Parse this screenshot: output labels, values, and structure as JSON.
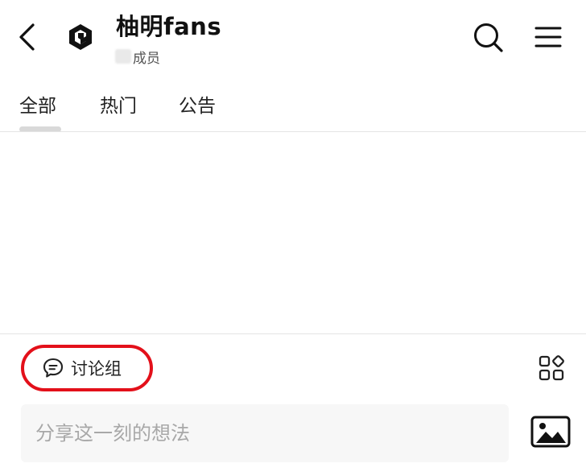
{
  "header": {
    "title": "柚明fans",
    "subtitle_suffix": "成员",
    "icons": {
      "back": "chevron-left-icon",
      "logo": "group-logo-icon",
      "search": "search-icon",
      "menu": "hamburger-menu-icon"
    }
  },
  "tabs": [
    {
      "label": "全部",
      "active": true
    },
    {
      "label": "热门",
      "active": false
    },
    {
      "label": "公告",
      "active": false
    }
  ],
  "discussion": {
    "label": "讨论组",
    "icon": "chat-bubble-icon",
    "highlight_color": "#e3101a"
  },
  "toolbar": {
    "grid_icon": "apps-grid-icon",
    "image_icon": "image-icon"
  },
  "composer": {
    "placeholder": "分享这一刻的想法",
    "value": ""
  }
}
